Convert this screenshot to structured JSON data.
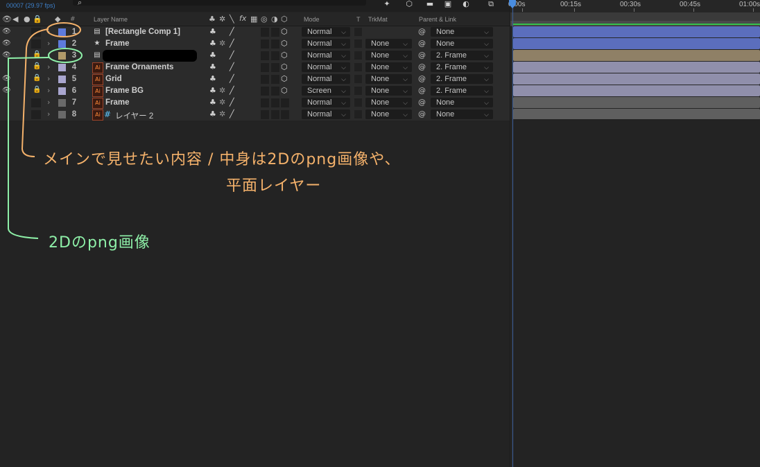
{
  "composition": {
    "timecode": "00007 (29.97 fps)"
  },
  "header": {
    "layer_name": "Layer Name",
    "mode": "Mode",
    "t": "T",
    "trkmat": "TrkMat",
    "parent_link": "Parent & Link"
  },
  "layers": [
    {
      "num": "1",
      "name": "[Rectangle Comp 1]",
      "mode": "Normal",
      "trkmat": "",
      "parent": "None",
      "label_color": "#5e7bdc",
      "type_icon": "comp-icon",
      "locked": false,
      "eye": true
    },
    {
      "num": "2",
      "name": "Frame",
      "mode": "Normal",
      "trkmat": "None",
      "parent": "None",
      "label_color": "#5e7bdc",
      "type_icon": "star-icon",
      "locked": false,
      "eye": true
    },
    {
      "num": "3",
      "name": "",
      "mode": "Normal",
      "trkmat": "None",
      "parent": "2. Frame",
      "label_color": "#b09a6a",
      "type_icon": "comp-icon",
      "locked": true,
      "eye": true
    },
    {
      "num": "4",
      "name": "Frame Ornaments",
      "mode": "Normal",
      "trkmat": "None",
      "parent": "2. Frame",
      "label_color": "#a9a6cf",
      "type_icon": "ai-icon",
      "locked": true,
      "eye": false
    },
    {
      "num": "5",
      "name": "Grid",
      "mode": "Normal",
      "trkmat": "None",
      "parent": "2. Frame",
      "label_color": "#a9a6cf",
      "type_icon": "ai-icon",
      "locked": true,
      "eye": true
    },
    {
      "num": "6",
      "name": "Frame BG",
      "mode": "Screen",
      "trkmat": "None",
      "parent": "2. Frame",
      "label_color": "#a9a6cf",
      "type_icon": "ai-icon",
      "locked": true,
      "eye": true
    },
    {
      "num": "7",
      "name": "Frame",
      "mode": "Normal",
      "trkmat": "None",
      "parent": "None",
      "label_color": "#6a6a6a",
      "type_icon": "ai-icon",
      "locked": false,
      "eye": false
    },
    {
      "num": "8",
      "name": "レイヤー 2",
      "mode": "Normal",
      "trkmat": "None",
      "parent": "None",
      "label_color": "#6a6a6a",
      "type_icon": "ai-icon",
      "locked": false,
      "eye": false
    }
  ],
  "timeline": {
    "ticks": [
      "0:00s",
      "00:15s",
      "00:30s",
      "00:45s",
      "01:00s"
    ],
    "bar_colors": [
      "#5b6ebd",
      "#5b6ebd",
      "#8f8066",
      "#908fab",
      "#908fab",
      "#908fab",
      "#5f5f5f",
      "#5f5f5f"
    ]
  },
  "annotations": {
    "orange_line1": "メインで見せたい内容 / 中身は2Dのpng画像や、",
    "orange_line2": "平面レイヤー",
    "green_line": "2Dのpng画像"
  },
  "colors": {
    "annotation_orange": "#f5b26b",
    "annotation_green": "#8ef0a8",
    "playhead": "#4a8de0"
  }
}
